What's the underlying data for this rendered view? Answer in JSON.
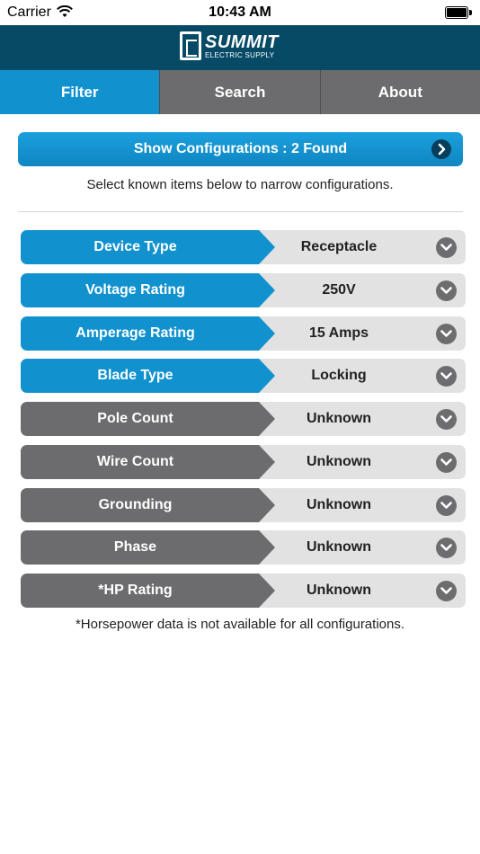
{
  "status_bar": {
    "carrier": "Carrier",
    "time": "10:43 AM"
  },
  "header": {
    "logo_title": "SUMMIT",
    "logo_subtitle": "ELECTRIC SUPPLY"
  },
  "tabs": [
    {
      "label": "Filter",
      "active": true
    },
    {
      "label": "Search",
      "active": false
    },
    {
      "label": "About",
      "active": false
    }
  ],
  "show_configurations": {
    "label": "Show Configurations : 2 Found",
    "icon": "chevron-right-icon"
  },
  "hint": "Select known items below to narrow configurations.",
  "filters": [
    {
      "label": "Device Type",
      "value": "Receptacle",
      "set": true
    },
    {
      "label": "Voltage Rating",
      "value": "250V",
      "set": true
    },
    {
      "label": "Amperage Rating",
      "value": "15 Amps",
      "set": true
    },
    {
      "label": "Blade Type",
      "value": "Locking",
      "set": true
    },
    {
      "label": "Pole Count",
      "value": "Unknown",
      "set": false
    },
    {
      "label": "Wire Count",
      "value": "Unknown",
      "set": false
    },
    {
      "label": "Grounding",
      "value": "Unknown",
      "set": false
    },
    {
      "label": "Phase",
      "value": "Unknown",
      "set": false
    },
    {
      "label": "*HP Rating",
      "value": "Unknown",
      "set": false
    }
  ],
  "footnote": "*Horsepower data is not available for all configurations.",
  "colors": {
    "header": "#074a66",
    "accent": "#1192cf",
    "gray_label": "#6c6c6e",
    "value_bg": "#e2e2e3"
  }
}
